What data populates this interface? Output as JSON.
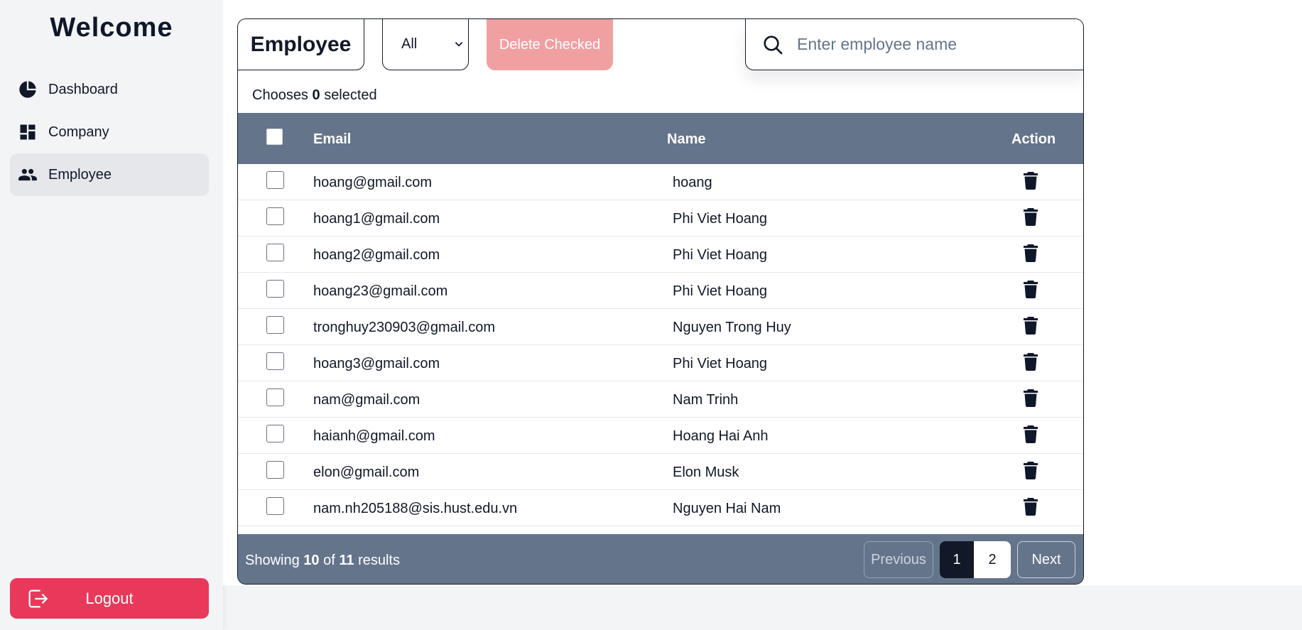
{
  "sidebar": {
    "title": "Welcome",
    "items": [
      {
        "label": "Dashboard",
        "icon": "pie-chart-icon"
      },
      {
        "label": "Company",
        "icon": "dashboard-grid-icon"
      },
      {
        "label": "Employee",
        "icon": "people-icon",
        "active": true
      }
    ],
    "logout_label": "Logout"
  },
  "header": {
    "title": "Employee",
    "filter_value": "All",
    "delete_label": "Delete Checked",
    "search_placeholder": "Enter employee name"
  },
  "selection": {
    "prefix": "Chooses",
    "count": "0",
    "suffix": "selected"
  },
  "table": {
    "columns": {
      "email": "Email",
      "name": "Name",
      "action": "Action"
    },
    "rows": [
      {
        "email": "hoang@gmail.com",
        "name": "hoang"
      },
      {
        "email": "hoang1@gmail.com",
        "name": "Phi Viet Hoang"
      },
      {
        "email": "hoang2@gmail.com",
        "name": "Phi Viet Hoang"
      },
      {
        "email": "hoang23@gmail.com",
        "name": "Phi Viet Hoang"
      },
      {
        "email": "tronghuy230903@gmail.com",
        "name": "Nguyen Trong Huy"
      },
      {
        "email": "hoang3@gmail.com",
        "name": "Phi Viet Hoang"
      },
      {
        "email": "nam@gmail.com",
        "name": "Nam Trinh"
      },
      {
        "email": "haianh@gmail.com",
        "name": "Hoang Hai Anh"
      },
      {
        "email": "elon@gmail.com",
        "name": "Elon Musk"
      },
      {
        "email": "nam.nh205188@sis.hust.edu.vn",
        "name": "Nguyen Hai Nam"
      }
    ]
  },
  "pagination": {
    "showing_prefix": "Showing",
    "shown": "10",
    "of_word": "of",
    "total": "11",
    "results_word": "results",
    "prev_label": "Previous",
    "pages": [
      "1",
      "2"
    ],
    "next_label": "Next"
  },
  "colors": {
    "header_bg": "#64748b",
    "logout_bg": "#e8395a",
    "delete_bg": "#f1a0a2",
    "active_page": "#111827"
  }
}
